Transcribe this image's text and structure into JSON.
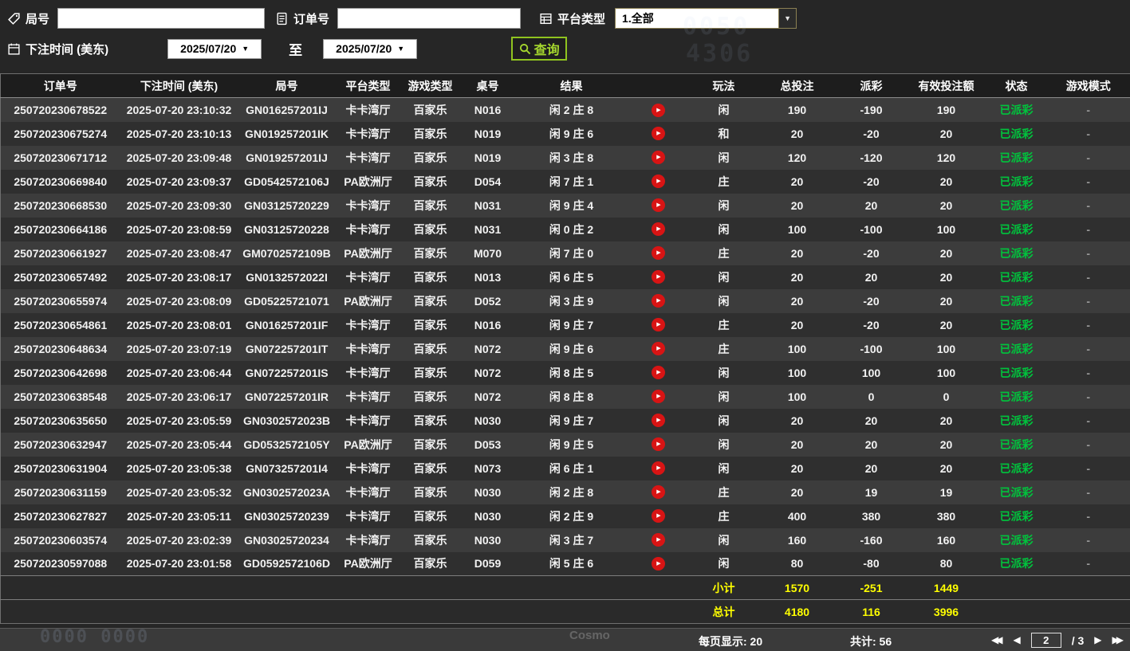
{
  "filters": {
    "round_label": "局号",
    "order_label": "订单号",
    "platform_label": "平台类型",
    "platform_value": "1.全部",
    "bet_time_label": "下注时间 (美东)",
    "date_from": "2025/07/20",
    "to_label": "至",
    "date_to": "2025/07/20",
    "query_label": "查询"
  },
  "background_text": {
    "top_right_1": "0050",
    "top_right_2": "4306",
    "bottom_left": "0000 0000",
    "bottom_center": "Cosmo"
  },
  "colors": {
    "payout_negative": "#00cf00",
    "payout_positive": "#b30000",
    "status_paid": "#00c43d",
    "summary_text": "#ffff00",
    "query_accent": "#8fc31f",
    "play_icon": "#d81414"
  },
  "table": {
    "headers": [
      "订单号",
      "下注时间 (美东)",
      "局号",
      "平台类型",
      "游戏类型",
      "桌号",
      "结果",
      "",
      "玩法",
      "总投注",
      "派彩",
      "有效投注额",
      "状态",
      "游戏模式"
    ],
    "rows": [
      {
        "order": "250720230678522",
        "time": "2025-07-20 23:10:32",
        "round": "GN016257201IJ",
        "platform": "卡卡湾厅",
        "game": "百家乐",
        "table_no": "N016",
        "result": "闲 2 庄 8",
        "play": "闲",
        "total": "190",
        "payout": "-190",
        "payout_color": "pay-green",
        "valid": "190",
        "status": "已派彩",
        "mode": "-"
      },
      {
        "order": "250720230675274",
        "time": "2025-07-20 23:10:13",
        "round": "GN019257201IK",
        "platform": "卡卡湾厅",
        "game": "百家乐",
        "table_no": "N019",
        "result": "闲 9 庄 6",
        "play": "和",
        "total": "20",
        "payout": "-20",
        "payout_color": "pay-green",
        "valid": "20",
        "status": "已派彩",
        "mode": "-"
      },
      {
        "order": "250720230671712",
        "time": "2025-07-20 23:09:48",
        "round": "GN019257201IJ",
        "platform": "卡卡湾厅",
        "game": "百家乐",
        "table_no": "N019",
        "result": "闲 3 庄 8",
        "play": "闲",
        "total": "120",
        "payout": "-120",
        "payout_color": "pay-green",
        "valid": "120",
        "status": "已派彩",
        "mode": "-"
      },
      {
        "order": "250720230669840",
        "time": "2025-07-20 23:09:37",
        "round": "GD0542572106J",
        "platform": "PA欧洲厅",
        "game": "百家乐",
        "table_no": "D054",
        "result": "闲 7 庄 1",
        "play": "庄",
        "total": "20",
        "payout": "-20",
        "payout_color": "pay-green",
        "valid": "20",
        "status": "已派彩",
        "mode": "-"
      },
      {
        "order": "250720230668530",
        "time": "2025-07-20 23:09:30",
        "round": "GN03125720229",
        "platform": "卡卡湾厅",
        "game": "百家乐",
        "table_no": "N031",
        "result": "闲 9 庄 4",
        "play": "闲",
        "total": "20",
        "payout": "20",
        "payout_color": "pay-red",
        "valid": "20",
        "status": "已派彩",
        "mode": "-"
      },
      {
        "order": "250720230664186",
        "time": "2025-07-20 23:08:59",
        "round": "GN03125720228",
        "platform": "卡卡湾厅",
        "game": "百家乐",
        "table_no": "N031",
        "result": "闲 0 庄 2",
        "play": "闲",
        "total": "100",
        "payout": "-100",
        "payout_color": "pay-green",
        "valid": "100",
        "status": "已派彩",
        "mode": "-"
      },
      {
        "order": "250720230661927",
        "time": "2025-07-20 23:08:47",
        "round": "GM0702572109B",
        "platform": "PA欧洲厅",
        "game": "百家乐",
        "table_no": "M070",
        "result": "闲 7 庄 0",
        "play": "庄",
        "total": "20",
        "payout": "-20",
        "payout_color": "pay-green",
        "valid": "20",
        "status": "已派彩",
        "mode": "-"
      },
      {
        "order": "250720230657492",
        "time": "2025-07-20 23:08:17",
        "round": "GN0132572022I",
        "platform": "卡卡湾厅",
        "game": "百家乐",
        "table_no": "N013",
        "result": "闲 6 庄 5",
        "play": "闲",
        "total": "20",
        "payout": "20",
        "payout_color": "pay-red",
        "valid": "20",
        "status": "已派彩",
        "mode": "-"
      },
      {
        "order": "250720230655974",
        "time": "2025-07-20 23:08:09",
        "round": "GD05225721071",
        "platform": "PA欧洲厅",
        "game": "百家乐",
        "table_no": "D052",
        "result": "闲 3 庄 9",
        "play": "闲",
        "total": "20",
        "payout": "-20",
        "payout_color": "pay-green",
        "valid": "20",
        "status": "已派彩",
        "mode": "-"
      },
      {
        "order": "250720230654861",
        "time": "2025-07-20 23:08:01",
        "round": "GN016257201IF",
        "platform": "卡卡湾厅",
        "game": "百家乐",
        "table_no": "N016",
        "result": "闲 9 庄 7",
        "play": "庄",
        "total": "20",
        "payout": "-20",
        "payout_color": "pay-green",
        "valid": "20",
        "status": "已派彩",
        "mode": "-"
      },
      {
        "order": "250720230648634",
        "time": "2025-07-20 23:07:19",
        "round": "GN072257201IT",
        "platform": "卡卡湾厅",
        "game": "百家乐",
        "table_no": "N072",
        "result": "闲 9 庄 6",
        "play": "庄",
        "total": "100",
        "payout": "-100",
        "payout_color": "pay-green",
        "valid": "100",
        "status": "已派彩",
        "mode": "-"
      },
      {
        "order": "250720230642698",
        "time": "2025-07-20 23:06:44",
        "round": "GN072257201IS",
        "platform": "卡卡湾厅",
        "game": "百家乐",
        "table_no": "N072",
        "result": "闲 8 庄 5",
        "play": "闲",
        "total": "100",
        "payout": "100",
        "payout_color": "pay-red",
        "valid": "100",
        "status": "已派彩",
        "mode": "-"
      },
      {
        "order": "250720230638548",
        "time": "2025-07-20 23:06:17",
        "round": "GN072257201IR",
        "platform": "卡卡湾厅",
        "game": "百家乐",
        "table_no": "N072",
        "result": "闲 8 庄 8",
        "play": "闲",
        "total": "100",
        "payout": "0",
        "payout_color": "pay-neutral",
        "valid": "0",
        "status": "已派彩",
        "mode": "-"
      },
      {
        "order": "250720230635650",
        "time": "2025-07-20 23:05:59",
        "round": "GN0302572023B",
        "platform": "卡卡湾厅",
        "game": "百家乐",
        "table_no": "N030",
        "result": "闲 9 庄 7",
        "play": "闲",
        "total": "20",
        "payout": "20",
        "payout_color": "pay-red",
        "valid": "20",
        "status": "已派彩",
        "mode": "-"
      },
      {
        "order": "250720230632947",
        "time": "2025-07-20 23:05:44",
        "round": "GD0532572105Y",
        "platform": "PA欧洲厅",
        "game": "百家乐",
        "table_no": "D053",
        "result": "闲 9 庄 5",
        "play": "闲",
        "total": "20",
        "payout": "20",
        "payout_color": "pay-red",
        "valid": "20",
        "status": "已派彩",
        "mode": "-"
      },
      {
        "order": "250720230631904",
        "time": "2025-07-20 23:05:38",
        "round": "GN073257201I4",
        "platform": "卡卡湾厅",
        "game": "百家乐",
        "table_no": "N073",
        "result": "闲 6 庄 1",
        "play": "闲",
        "total": "20",
        "payout": "20",
        "payout_color": "pay-red",
        "valid": "20",
        "status": "已派彩",
        "mode": "-"
      },
      {
        "order": "250720230631159",
        "time": "2025-07-20 23:05:32",
        "round": "GN0302572023A",
        "platform": "卡卡湾厅",
        "game": "百家乐",
        "table_no": "N030",
        "result": "闲 2 庄 8",
        "play": "庄",
        "total": "20",
        "payout": "19",
        "payout_color": "pay-red",
        "valid": "19",
        "status": "已派彩",
        "mode": "-"
      },
      {
        "order": "250720230627827",
        "time": "2025-07-20 23:05:11",
        "round": "GN03025720239",
        "platform": "卡卡湾厅",
        "game": "百家乐",
        "table_no": "N030",
        "result": "闲 2 庄 9",
        "play": "庄",
        "total": "400",
        "payout": "380",
        "payout_color": "pay-red",
        "valid": "380",
        "status": "已派彩",
        "mode": "-"
      },
      {
        "order": "250720230603574",
        "time": "2025-07-20 23:02:39",
        "round": "GN03025720234",
        "platform": "卡卡湾厅",
        "game": "百家乐",
        "table_no": "N030",
        "result": "闲 3 庄 7",
        "play": "闲",
        "total": "160",
        "payout": "-160",
        "payout_color": "pay-green",
        "valid": "160",
        "status": "已派彩",
        "mode": "-"
      },
      {
        "order": "250720230597088",
        "time": "2025-07-20 23:01:58",
        "round": "GD0592572106D",
        "platform": "PA欧洲厅",
        "game": "百家乐",
        "table_no": "D059",
        "result": "闲 5 庄 6",
        "play": "闲",
        "total": "80",
        "payout": "-80",
        "payout_color": "pay-green",
        "valid": "80",
        "status": "已派彩",
        "mode": "-"
      }
    ],
    "subtotal": {
      "label": "小计",
      "total": "1570",
      "payout": "-251",
      "valid": "1449"
    },
    "grand_total": {
      "label": "总计",
      "total": "4180",
      "payout": "116",
      "valid": "3996"
    }
  },
  "footer": {
    "per_page": "每页显示: 20",
    "total_count": "共计: 56",
    "page": "2",
    "page_suffix": "/ 3"
  }
}
